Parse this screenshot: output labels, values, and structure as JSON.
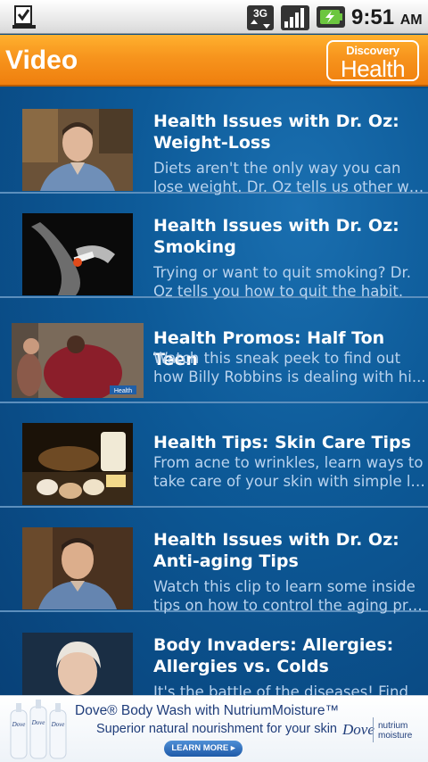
{
  "status_bar": {
    "notification_icon": "download-complete-icon",
    "network_label": "3G",
    "time": "9:51",
    "ampm": "AM"
  },
  "header": {
    "title": "Video",
    "brand_top": "Discovery",
    "brand_bottom": "Health"
  },
  "videos": [
    {
      "title": "Health Issues with Dr. Oz: Weight-Loss",
      "desc_line1": "Diets aren't the only way you can",
      "desc_line2": "lose weight. Dr. Oz tells us other wa..."
    },
    {
      "title": "Health Issues with Dr. Oz: Smoking",
      "desc_line1": "Trying or want to quit smoking? Dr.",
      "desc_line2": "Oz tells you how to quit the habit."
    },
    {
      "title": "Health Promos: Half Ton Teen",
      "desc_line1": "Watch this sneak peek to find out",
      "desc_line2": "how Billy Robbins is dealing with hi..."
    },
    {
      "title": "Health Tips: Skin Care Tips",
      "desc_line1": "From acne to wrinkles, learn ways to",
      "desc_line2": "take care of your skin with simple li..."
    },
    {
      "title": "Health Issues with Dr. Oz: Anti-aging Tips",
      "desc_line1": "Watch this clip to learn some inside",
      "desc_line2": "tips on how to control the aging pro..."
    },
    {
      "title": "Body Invaders: Allergies: Allergies vs. Colds",
      "desc_line1": "It's the battle of the diseases! Find",
      "desc_line2": ""
    }
  ],
  "thumb_watermark": "Health",
  "ad": {
    "headline": "Dove® Body Wash with NutriumMoisture™",
    "subline": "Superior natural nourishment for your skin",
    "cta": "LEARN MORE ▸",
    "brand": "Dove",
    "brand_sub": "nutrium moisture",
    "bottle_label": "Dove"
  },
  "colors": {
    "header_orange": "#f7941d",
    "list_blue": "#0d5a98",
    "desc_text": "#b9d3ee",
    "ad_blue": "#1f3d7a"
  }
}
